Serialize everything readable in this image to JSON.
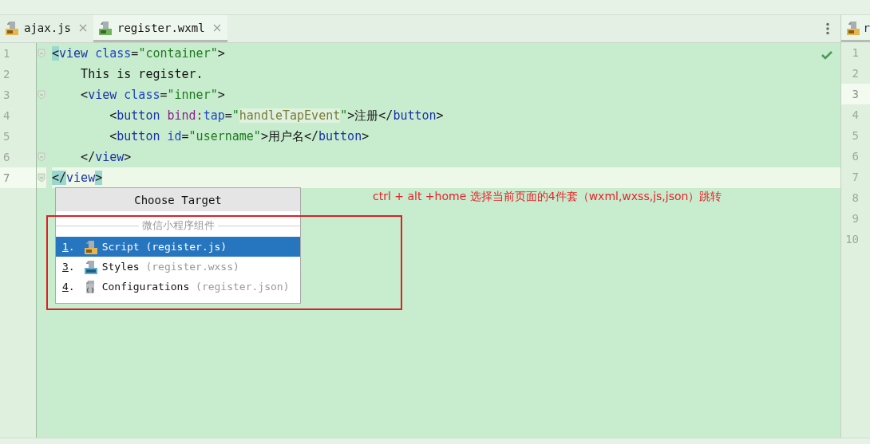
{
  "tabs": [
    {
      "label": "ajax.js",
      "kind": "js",
      "selected": false
    },
    {
      "label": "register.wxml",
      "kind": "wxml",
      "selected": true
    }
  ],
  "editor": {
    "inspection_ok": true,
    "line_numbers": [
      {
        "number": "1",
        "current": false
      },
      {
        "number": "2",
        "current": false
      },
      {
        "number": "3",
        "current": false
      },
      {
        "number": "4",
        "current": false
      },
      {
        "number": "5",
        "current": false
      },
      {
        "number": "6",
        "current": false
      },
      {
        "number": "7",
        "current": true
      }
    ],
    "lines": [
      [
        {
          "kind": "brace",
          "text": "<"
        },
        {
          "kind": "tag",
          "text": "view"
        },
        {
          "kind": "attr",
          "text": " class"
        },
        {
          "kind": "punct",
          "text": "="
        },
        {
          "kind": "string",
          "text": "\"container\""
        },
        {
          "kind": "punct",
          "text": ">"
        }
      ],
      [
        {
          "kind": "text",
          "text": "    This is register."
        }
      ],
      [
        {
          "kind": "punct",
          "text": "    <"
        },
        {
          "kind": "tag",
          "text": "view"
        },
        {
          "kind": "attr",
          "text": " class"
        },
        {
          "kind": "punct",
          "text": "="
        },
        {
          "kind": "string",
          "text": "\"inner\""
        },
        {
          "kind": "punct",
          "text": ">"
        }
      ],
      [
        {
          "kind": "punct",
          "text": "        <"
        },
        {
          "kind": "tag",
          "text": "button"
        },
        {
          "kind": "event",
          "text": " bind:"
        },
        {
          "kind": "attr",
          "text": "tap"
        },
        {
          "kind": "punct",
          "text": "="
        },
        {
          "kind": "string",
          "text": "\""
        },
        {
          "kind": "ref",
          "text": "handleTapEvent"
        },
        {
          "kind": "string",
          "text": "\""
        },
        {
          "kind": "punct",
          "text": ">"
        },
        {
          "kind": "text",
          "text": "注册"
        },
        {
          "kind": "punct",
          "text": "</"
        },
        {
          "kind": "tag",
          "text": "button"
        },
        {
          "kind": "punct",
          "text": ">"
        }
      ],
      [
        {
          "kind": "punct",
          "text": "        <"
        },
        {
          "kind": "tag",
          "text": "button"
        },
        {
          "kind": "attr",
          "text": " id"
        },
        {
          "kind": "punct",
          "text": "="
        },
        {
          "kind": "string",
          "text": "\"username\""
        },
        {
          "kind": "punct",
          "text": ">"
        },
        {
          "kind": "text",
          "text": "用户名"
        },
        {
          "kind": "punct",
          "text": "</"
        },
        {
          "kind": "tag",
          "text": "button"
        },
        {
          "kind": "punct",
          "text": ">"
        }
      ],
      [
        {
          "kind": "punct",
          "text": "    </"
        },
        {
          "kind": "tag",
          "text": "view"
        },
        {
          "kind": "punct",
          "text": ">"
        }
      ],
      [
        {
          "kind": "brace",
          "text": "</"
        },
        {
          "kind": "tag",
          "text": "view"
        },
        {
          "kind": "brace",
          "text": ">"
        }
      ]
    ],
    "fold_markers": [
      true,
      false,
      true,
      false,
      false,
      true,
      true
    ]
  },
  "popup": {
    "title": "Choose Target",
    "group": "微信小程序组件",
    "items": [
      {
        "number": "1.",
        "name": "Script",
        "file": "(register.js)",
        "kind": "js",
        "selected": true
      },
      {
        "number": "3.",
        "name": "Styles",
        "file": "(register.wxss)",
        "kind": "wxss",
        "selected": false
      },
      {
        "number": "4.",
        "name": "Configurations",
        "file": "(register.json)",
        "kind": "json",
        "selected": false
      }
    ]
  },
  "annotation": "ctrl + alt +home 选择当前页面的4件套（wxml,wxss,js,json）跳转",
  "right_pane": {
    "tab": {
      "label": "r",
      "kind": "js"
    },
    "line_numbers": [
      {
        "number": "1",
        "current": false
      },
      {
        "number": "2",
        "current": false
      },
      {
        "number": "3",
        "current": true
      },
      {
        "number": "4",
        "current": false
      },
      {
        "number": "5",
        "current": false
      },
      {
        "number": "6",
        "current": false
      },
      {
        "number": "7",
        "current": false
      },
      {
        "number": "8",
        "current": false
      },
      {
        "number": "9",
        "current": false
      },
      {
        "number": "10",
        "current": false
      }
    ]
  }
}
